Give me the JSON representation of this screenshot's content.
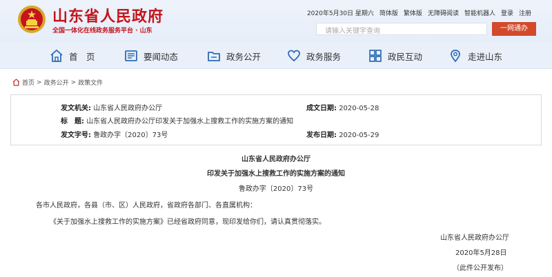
{
  "header": {
    "title": "山东省人民政府",
    "subtitle": "全国一体化在线政务服务平台 · 山东",
    "emblem_icon": "national-emblem-icon",
    "brand_color": "#c4151c"
  },
  "topbar": {
    "date": "2020年5月30日 星期六",
    "simplified": "简体版",
    "traditional": "繁体版",
    "accessible": "无障碍阅读",
    "robot": "智能机器人",
    "login": "登录",
    "register": "注册"
  },
  "search": {
    "placeholder": "请输入关键字查询",
    "button": "一网通办",
    "button_color": "#d24a2a"
  },
  "nav": {
    "items": [
      {
        "label": "首　页",
        "icon": "home-icon"
      },
      {
        "label": "要闻动态",
        "icon": "news-icon"
      },
      {
        "label": "政务公开",
        "icon": "folder-icon"
      },
      {
        "label": "政务服务",
        "icon": "heart-icon"
      },
      {
        "label": "政民互动",
        "icon": "interaction-icon"
      },
      {
        "label": "走进山东",
        "icon": "location-icon"
      }
    ],
    "icon_color": "#2d6bb3"
  },
  "breadcrumb": {
    "items": [
      "首页",
      "政务公开",
      "政策文件"
    ],
    "separator": ">",
    "icon": "home-icon"
  },
  "info": {
    "issuer_label": "发文机关:",
    "issuer": "山东省人民政府办公厅",
    "date_label": "成文日期:",
    "date": "2020-05-28",
    "title_label": "标　题:",
    "title": "山东省人民政府办公厅印发关于加强水上搜救工作的实施方案的通知",
    "docno_label": "发文字号:",
    "docno": "鲁政办字〔2020〕73号",
    "publish_label": "发布日期:",
    "publish": "2020-05-29"
  },
  "doc": {
    "heading1": "山东省人民政府办公厅",
    "heading2": "印发关于加强水上搜救工作的实施方案的通知",
    "docno": "鲁政办字〔2020〕73号",
    "addressee": "各市人民政府，各县（市、区）人民政府，省政府各部门、各直属机构：",
    "body": "《关于加强水上搜救工作的实施方案》已经省政府同意，现印发给你们，请认真贯彻落实。",
    "signature": "山东省人民政府办公厅",
    "sign_date": "2020年5月28日",
    "note": "（此件公开发布）"
  }
}
